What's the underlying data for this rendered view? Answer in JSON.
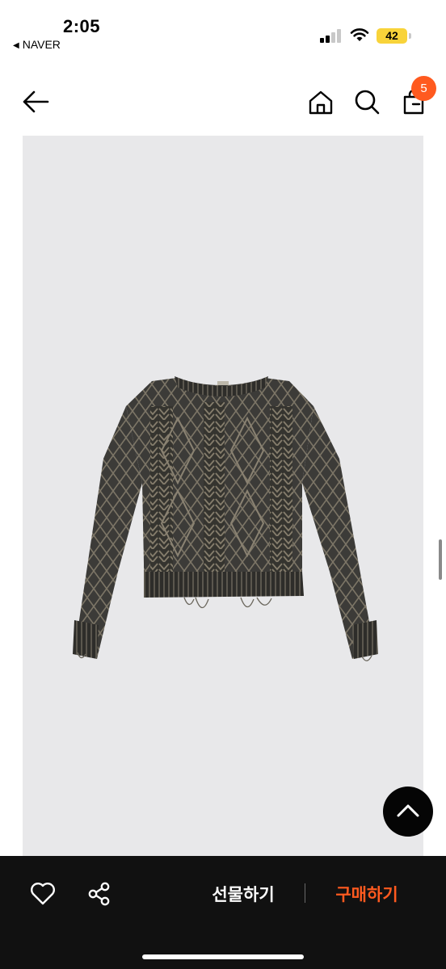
{
  "status_bar": {
    "time": "2:05",
    "back_app": "NAVER",
    "back_symbol": "◀",
    "battery_level": "42"
  },
  "header": {
    "cart_count": "5",
    "icons": [
      "back-arrow-icon",
      "home-icon",
      "search-icon",
      "shopping-bag-icon"
    ]
  },
  "product": {
    "image": "knit-sweater-photo"
  },
  "bottom_bar": {
    "gift_label": "선물하기",
    "buy_label": "구매하기",
    "buy_color": "#ff5a1f",
    "icons": [
      "heart-icon",
      "share-icon"
    ]
  },
  "colors": {
    "accent": "#ff5a1f",
    "bar_background": "#111111",
    "image_background": "#e8e8ea",
    "battery": "#f8d33a"
  }
}
